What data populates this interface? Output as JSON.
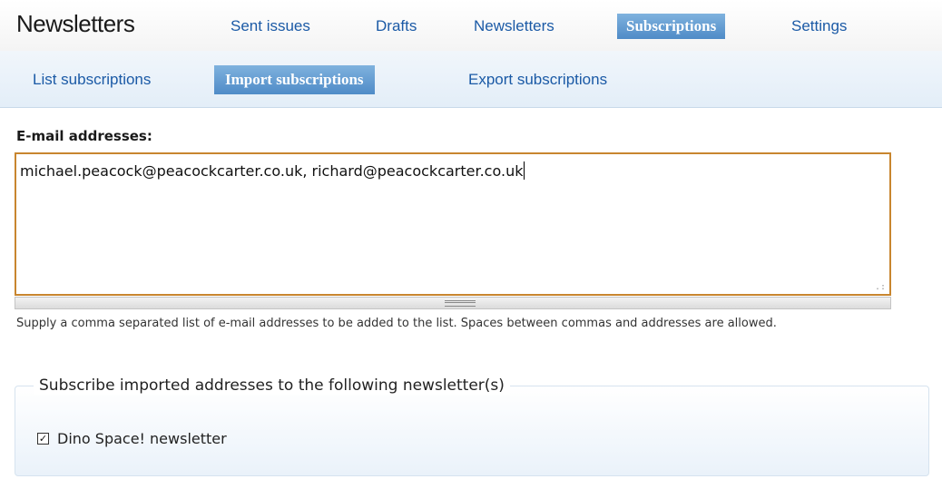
{
  "header": {
    "app_title": "Newsletters",
    "tabs": [
      {
        "label": "Sent issues",
        "active": false
      },
      {
        "label": "Drafts",
        "active": false
      },
      {
        "label": "Newsletters",
        "active": false
      },
      {
        "label": "Subscriptions",
        "active": true
      },
      {
        "label": "Settings",
        "active": false
      }
    ]
  },
  "subnav": {
    "tabs": [
      {
        "label": "List subscriptions",
        "active": false
      },
      {
        "label": "Import subscriptions",
        "active": true
      },
      {
        "label": "Export subscriptions",
        "active": false
      }
    ]
  },
  "form": {
    "email_label": "E-mail addresses:",
    "email_value": "michael.peacock@peacockcarter.co.uk, richard@peacockcarter.co.uk",
    "description": "Supply a comma separated list of e-mail addresses to be added to the list. Spaces between commas and addresses are allowed.",
    "subscribe_legend": "Subscribe imported addresses to the following newsletter(s)",
    "newsletters": [
      {
        "label": "Dino Space! newsletter",
        "checked": true
      }
    ]
  },
  "colors": {
    "link": "#1b5aa6",
    "active_tab": "#5f97cf",
    "focus_border": "#c8862f"
  },
  "icons": {
    "checkbox": "checkbox-checked-icon",
    "resize": "resize-grip-icon"
  }
}
